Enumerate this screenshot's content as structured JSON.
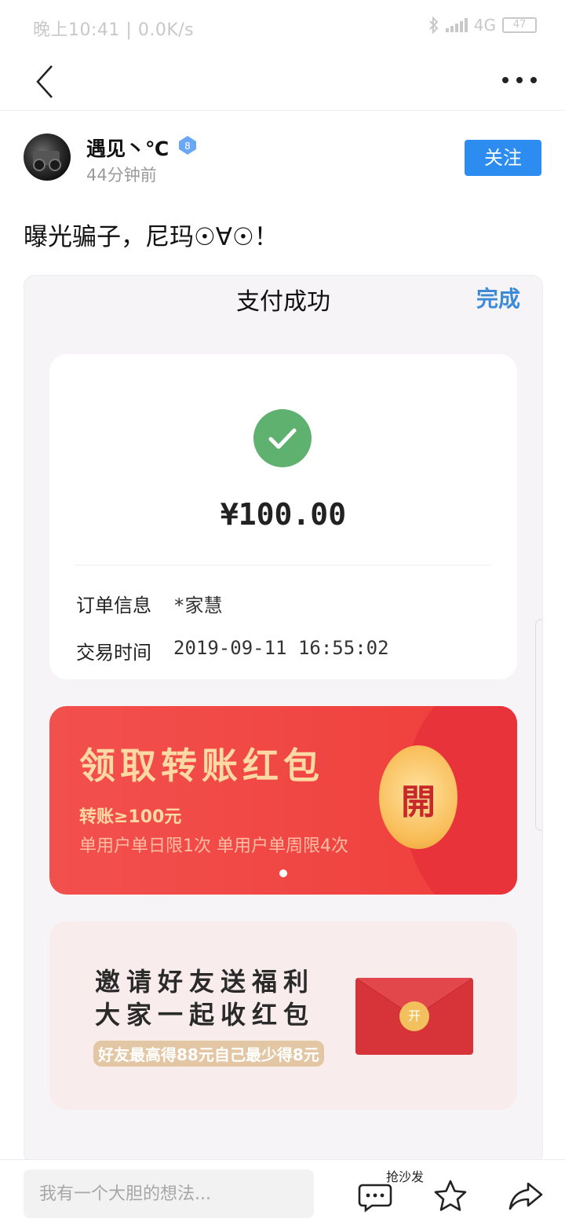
{
  "status_bar": {
    "time": "晚上10:41",
    "speed": "0.0K/s",
    "network": "4G",
    "battery": "47"
  },
  "nav": {
    "back_icon": "chevron-left-icon",
    "more_icon": "more-dots-icon"
  },
  "author": {
    "name": "遇见丶℃",
    "level": "8",
    "time": "44分钟前",
    "follow_label": "关注"
  },
  "post": {
    "text": "曝光骗子，尼玛☉∀☉！"
  },
  "screenshot": {
    "title": "支付成功",
    "done": "完成",
    "amount": "¥100.00",
    "rows": [
      {
        "label": "订单信息",
        "value": "*家慧"
      },
      {
        "label": "交易时间",
        "value": "2019-09-11 16:55:02"
      }
    ],
    "redpack": {
      "title": "领取转账红包",
      "line1": "转账≥100元",
      "line2": "单用户单日限1次 单用户单周限4次",
      "coin": "開"
    },
    "invite": {
      "line1": "邀请好友送福利",
      "line2": "大家一起收红包",
      "sub": "好友最高得88元自己最少得8元",
      "envelope_text": "开"
    }
  },
  "bottom_bar": {
    "comment_placeholder": "我有一个大胆的想法...",
    "sofa_label": "抢沙发",
    "comment_icon": "comment-icon",
    "favorite_icon": "star-icon",
    "share_icon": "share-icon"
  },
  "colors": {
    "accent": "#2d8cf0",
    "success": "#5fb16f",
    "red_packet": "#f04441"
  }
}
